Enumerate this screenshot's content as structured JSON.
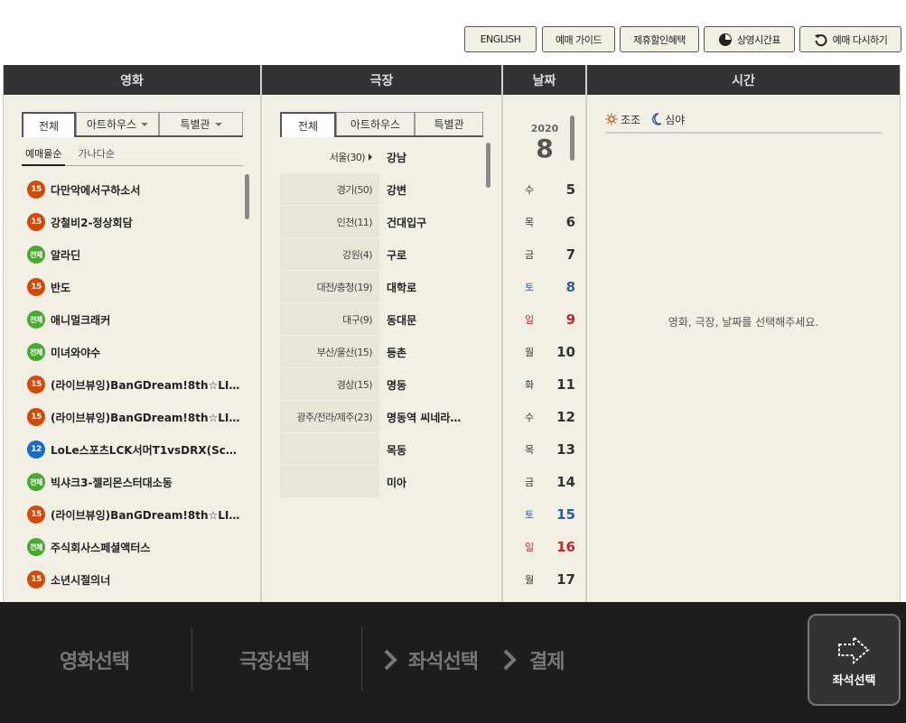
{
  "topbar": {
    "english": "ENGLISH",
    "guide": "예매 가이드",
    "discount": "제휴할인혜택",
    "timetable": "상영시간표",
    "restart": "예매 다시하기"
  },
  "movie": {
    "header": "영화",
    "tabs": [
      "전체",
      "아트하우스",
      "특별관"
    ],
    "sorts": [
      "예매율순",
      "가나다순"
    ],
    "items": [
      {
        "rating": "15",
        "title": "다만악에서구하소서"
      },
      {
        "rating": "15",
        "title": "강철비2-정상회담"
      },
      {
        "rating": "전체",
        "title": "알라딘"
      },
      {
        "rating": "15",
        "title": "반도"
      },
      {
        "rating": "전체",
        "title": "애니멀크래커"
      },
      {
        "rating": "전체",
        "title": "미녀와야수"
      },
      {
        "rating": "15",
        "title": "(라이브뷰잉)BanGDream!8th☆LI…"
      },
      {
        "rating": "15",
        "title": "(라이브뷰잉)BanGDream!8th☆LI…"
      },
      {
        "rating": "12",
        "title": "LoLe스포츠LCK서머T1vsDRX(Scr…"
      },
      {
        "rating": "전체",
        "title": "빅샤크3-젤리몬스터대소동"
      },
      {
        "rating": "15",
        "title": "(라이브뷰잉)BanGDream!8th☆LI…"
      },
      {
        "rating": "전체",
        "title": "주식회사스페셜액터스"
      },
      {
        "rating": "15",
        "title": "소년시절의너"
      }
    ]
  },
  "theater": {
    "header": "극장",
    "tabs": [
      "전체",
      "아트하우스",
      "특별관"
    ],
    "rows": [
      {
        "region": "서울(30)",
        "name": "강남"
      },
      {
        "region": "경기(50)",
        "name": "강변"
      },
      {
        "region": "인천(11)",
        "name": "건대입구"
      },
      {
        "region": "강원(4)",
        "name": "구로"
      },
      {
        "region": "대전/충청(19)",
        "name": "대학로"
      },
      {
        "region": "대구(9)",
        "name": "동대문"
      },
      {
        "region": "부산/울산(15)",
        "name": "등촌"
      },
      {
        "region": "경상(15)",
        "name": "명동"
      },
      {
        "region": "광주/전라/제주(23)",
        "name": "명동역 씨네라…"
      },
      {
        "region": "",
        "name": "목동"
      },
      {
        "region": "",
        "name": "미아"
      }
    ]
  },
  "date": {
    "header": "날짜",
    "year": "2020",
    "month": "8",
    "days": [
      {
        "dow": "수",
        "day": "5",
        "type": "weekday"
      },
      {
        "dow": "목",
        "day": "6",
        "type": "weekday"
      },
      {
        "dow": "금",
        "day": "7",
        "type": "weekday"
      },
      {
        "dow": "토",
        "day": "8",
        "type": "sat"
      },
      {
        "dow": "일",
        "day": "9",
        "type": "sun"
      },
      {
        "dow": "월",
        "day": "10",
        "type": "weekday"
      },
      {
        "dow": "화",
        "day": "11",
        "type": "weekday"
      },
      {
        "dow": "수",
        "day": "12",
        "type": "weekday"
      },
      {
        "dow": "목",
        "day": "13",
        "type": "weekday"
      },
      {
        "dow": "금",
        "day": "14",
        "type": "weekday"
      },
      {
        "dow": "토",
        "day": "15",
        "type": "sat"
      },
      {
        "dow": "일",
        "day": "16",
        "type": "sun"
      },
      {
        "dow": "월",
        "day": "17",
        "type": "weekday"
      }
    ]
  },
  "time": {
    "header": "시간",
    "morning": "조조",
    "night": "심야",
    "message": "영화, 극장, 날짜를 선택해주세요."
  },
  "steps": {
    "movie": "영화선택",
    "theater": "극장선택",
    "seat": "좌석선택",
    "pay": "결제",
    "next_button": "좌석선택"
  },
  "colors": {
    "panel_bg": "#f2f0e5",
    "header_bg": "#333333",
    "rating_15": "#d04a0a",
    "rating_12": "#1b6bc4",
    "rating_all": "#4aa732",
    "saturday": "#2d5d9f",
    "sunday": "#c0282d"
  }
}
